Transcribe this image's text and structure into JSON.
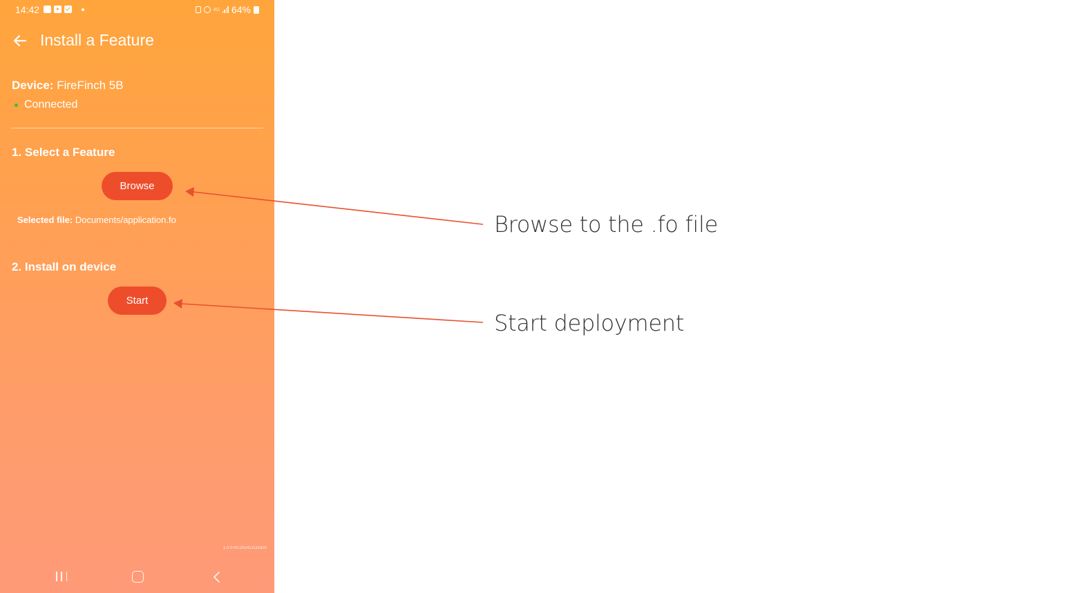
{
  "status_bar": {
    "time": "14:42",
    "network": "4G",
    "battery": "64%"
  },
  "header": {
    "title": "Install a Feature"
  },
  "device": {
    "label": "Device:",
    "name": "FireFinch 5B",
    "status": "Connected",
    "status_color": "#3dbb4a"
  },
  "step1": {
    "title": "1. Select a Feature",
    "button": "Browse",
    "selected_label": "Selected file:",
    "selected_value": "Documents/application.fo"
  },
  "step2": {
    "title": "2. Install on device",
    "button": "Start"
  },
  "version": "1.0.0-RC202412111820",
  "annotations": {
    "browse_note": "Browse to the .fo file",
    "start_note": "Start deployment",
    "arrow_color": "#e8502e"
  },
  "colors": {
    "accent_button": "#ee4d2c",
    "gradient_top": "#ffa53b",
    "gradient_bottom": "#ff9a78"
  }
}
